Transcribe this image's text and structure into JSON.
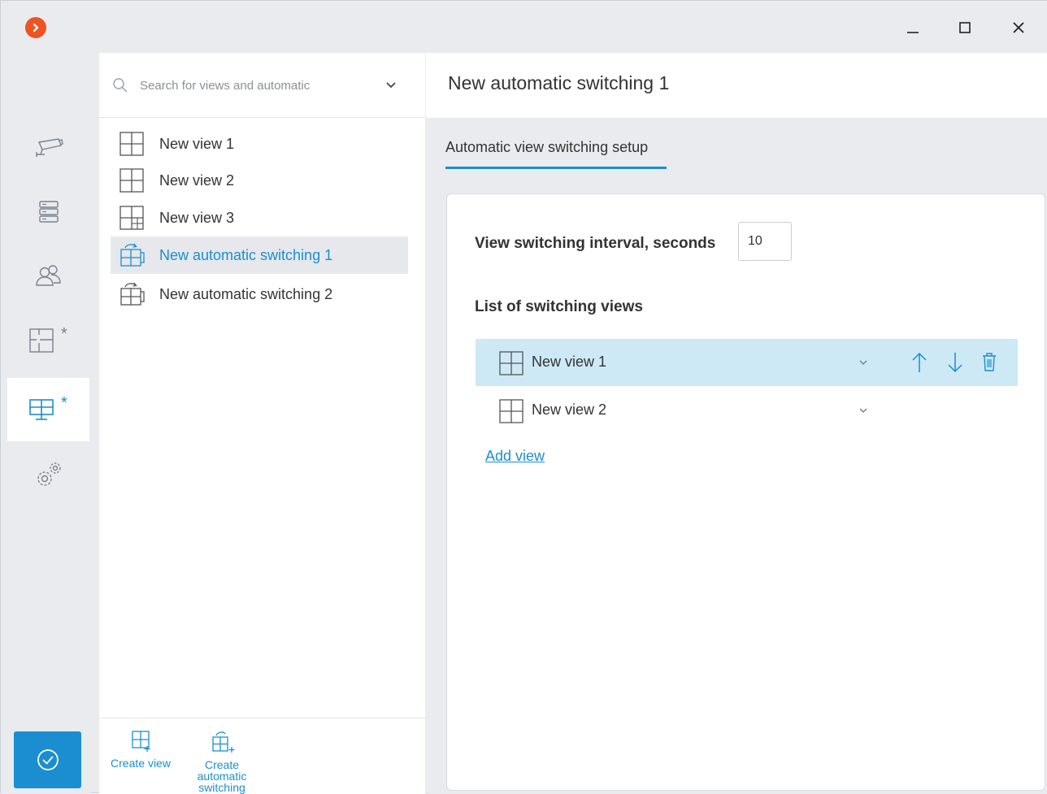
{
  "window": {
    "app_icon": "app-logo-icon",
    "controls": [
      "minimize-icon",
      "maximize-icon",
      "close-icon"
    ]
  },
  "rail": {
    "items": [
      {
        "name": "cameras",
        "icon": "camera-icon",
        "modified": false
      },
      {
        "name": "servers",
        "icon": "server-icon",
        "modified": false
      },
      {
        "name": "users",
        "icon": "users-icon",
        "modified": false
      },
      {
        "name": "layouts",
        "icon": "layout-icon",
        "modified": true,
        "marker": "*"
      },
      {
        "name": "views",
        "icon": "monitor-view-icon",
        "modified": true,
        "marker": "*",
        "active": true
      },
      {
        "name": "settings",
        "icon": "gears-icon",
        "modified": false
      }
    ],
    "apply_icon": "checkmark-icon"
  },
  "list_panel": {
    "search": {
      "placeholder": "Search for views and automatic"
    },
    "items": [
      {
        "label": "New view 1",
        "icon": "view-grid-icon",
        "selected": false
      },
      {
        "label": "New view 2",
        "icon": "view-grid-icon",
        "selected": false
      },
      {
        "label": "New view 3",
        "icon": "view-grid-mixed-icon",
        "selected": false
      },
      {
        "label": "New automatic switching 1",
        "icon": "auto-switch-icon",
        "selected": true
      },
      {
        "label": "New automatic switching 2",
        "icon": "auto-switch-icon",
        "selected": false
      }
    ],
    "footer": {
      "create_view": "Create view",
      "create_switch_line1": "Create",
      "create_switch_line2": "automatic",
      "create_switch_line3": "switching"
    }
  },
  "detail": {
    "title": "New automatic switching 1",
    "tab": "Automatic view switching setup",
    "interval_label": "View switching interval, seconds",
    "interval_value": "10",
    "list_title": "List of switching views",
    "switching_views": [
      {
        "label": "New view 1",
        "selected": true
      },
      {
        "label": "New view 2",
        "selected": false
      }
    ],
    "add_view": "Add view"
  },
  "colors": {
    "accent": "#1a8ed1",
    "logo": "#ee5322",
    "selected_row": "#cde9f6",
    "background": "#e9ebee"
  }
}
